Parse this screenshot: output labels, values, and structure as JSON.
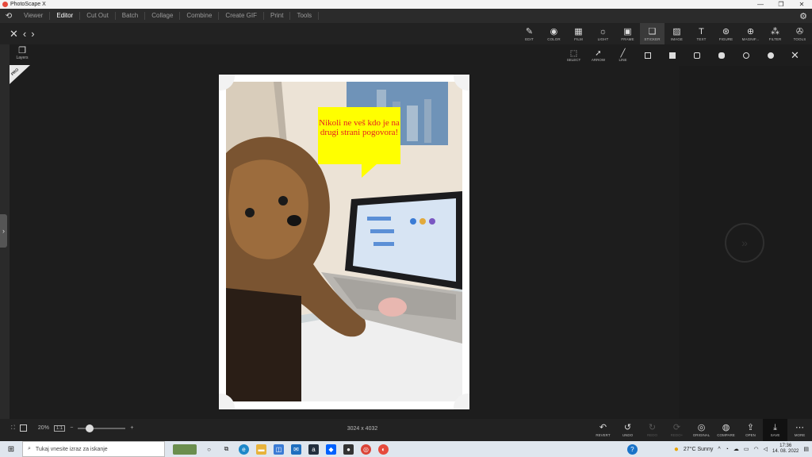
{
  "window": {
    "title": "PhotoScape X"
  },
  "menu": {
    "items": [
      "Viewer",
      "Editor",
      "Cut Out",
      "Batch",
      "Collage",
      "Combine",
      "Create GIF",
      "Print",
      "Tools"
    ],
    "active": "Editor"
  },
  "tools": [
    {
      "label": "EDIT",
      "icon": "edit-icon",
      "glyph": "✎"
    },
    {
      "label": "COLOR",
      "icon": "color-icon",
      "glyph": "◉"
    },
    {
      "label": "FILM",
      "icon": "film-icon",
      "glyph": "▦"
    },
    {
      "label": "LIGHT",
      "icon": "light-icon",
      "glyph": "☼"
    },
    {
      "label": "FRAME",
      "icon": "frame-icon",
      "glyph": "▣"
    },
    {
      "label": "STICKER",
      "icon": "sticker-icon",
      "glyph": "❏"
    },
    {
      "label": "IMAGE",
      "icon": "image-icon",
      "glyph": "▨"
    },
    {
      "label": "TEXT",
      "icon": "text-icon",
      "glyph": "T"
    },
    {
      "label": "FIGURE",
      "icon": "figure-icon",
      "glyph": "⊛"
    },
    {
      "label": "MAGNIF...",
      "icon": "magnifier-icon",
      "glyph": "⊕"
    },
    {
      "label": "FILTER",
      "icon": "filter-icon",
      "glyph": "⁂"
    },
    {
      "label": "TOOLS",
      "icon": "tools-icon",
      "glyph": "✇"
    }
  ],
  "sticker_tools": [
    {
      "label": "SELECT",
      "glyph": "⬚"
    },
    {
      "label": "ARROW",
      "glyph": "➚"
    },
    {
      "label": "LINE",
      "glyph": "╱"
    }
  ],
  "layers_label": "Layers",
  "pro_badge": "PRO",
  "speech_bubble": {
    "text": "Nikoli ne veš kdo je na drugi strani pogovora!"
  },
  "bottom": {
    "zoom": "20%",
    "ratio": "1:1",
    "dimensions": "3024 x 4032",
    "actions": [
      {
        "label": "REVERT",
        "glyph": "↶",
        "enabled": true
      },
      {
        "label": "UNDO",
        "glyph": "↺",
        "enabled": true
      },
      {
        "label": "REDO",
        "glyph": "↻",
        "enabled": false
      },
      {
        "label": "REDO+",
        "glyph": "⟳",
        "enabled": false
      },
      {
        "label": "ORIGINAL",
        "glyph": "◎",
        "enabled": true
      },
      {
        "label": "COMPARE",
        "glyph": "◍",
        "enabled": true
      },
      {
        "label": "OPEN",
        "glyph": "⇪",
        "enabled": true
      },
      {
        "label": "SAVE",
        "glyph": "⤓",
        "enabled": true
      },
      {
        "label": "MORE",
        "glyph": "⋯",
        "enabled": true
      }
    ]
  },
  "taskbar": {
    "search_placeholder": "Tukaj vnesite izraz za iskanje",
    "weather": "27°C  Sunny",
    "time": "17:36",
    "date": "14. 08. 2022"
  },
  "colors": {
    "bubble": "#ffff00",
    "bubble_text": "#e62020",
    "accent": "#e64a3c"
  }
}
